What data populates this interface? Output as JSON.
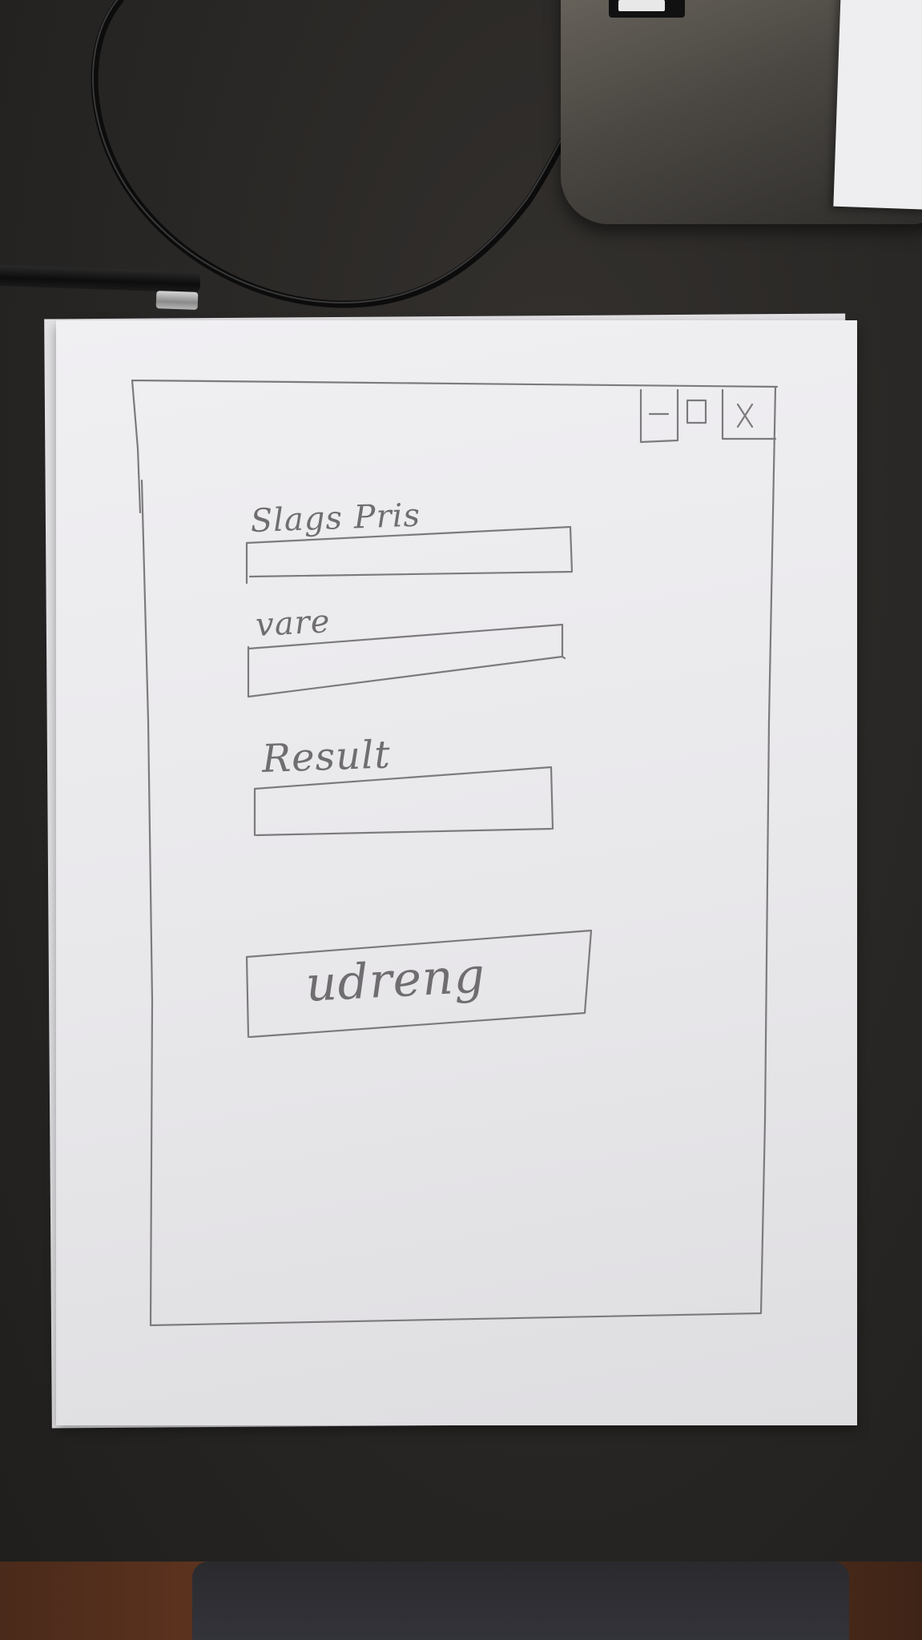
{
  "window": {
    "controls": {
      "minimize_icon": "minimize-icon",
      "maximize_icon": "maximize-icon",
      "close_icon": "close-icon"
    }
  },
  "form": {
    "field1_label": "Slags Pris",
    "field1_value": "",
    "field2_label": "vare",
    "field2_value": "",
    "field3_label": "Result",
    "field3_value": "",
    "button_label": "udreng"
  },
  "colors": {
    "pencil": "#7c7a7c",
    "paper": "#ecebee",
    "desk": "#2a2826"
  }
}
